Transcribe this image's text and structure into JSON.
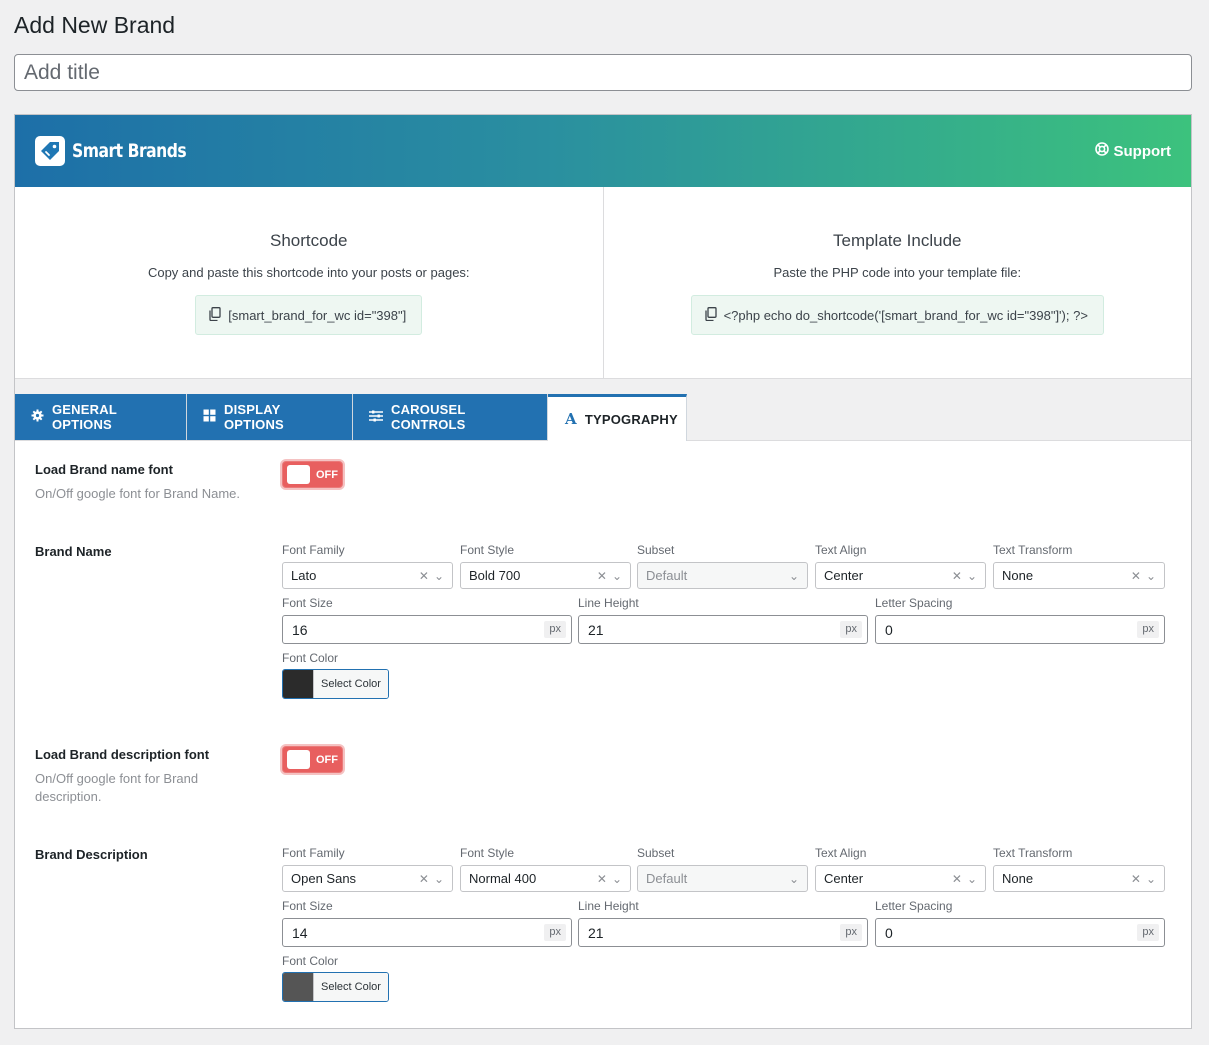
{
  "page": {
    "heading": "Add New Brand",
    "title_placeholder": "Add title"
  },
  "banner": {
    "logo_text": "Smart Brands",
    "support_label": "Support"
  },
  "shortcode": {
    "title": "Shortcode",
    "description": "Copy and paste this shortcode into your posts or pages:",
    "code": "[smart_brand_for_wc id=\"398\"]"
  },
  "template": {
    "title": "Template Include",
    "description": "Paste the PHP code into your template file:",
    "code": "<?php echo do_shortcode('[smart_brand_for_wc id=\"398\"]'); ?>"
  },
  "tabs": [
    {
      "label": "GENERAL OPTIONS",
      "icon": "gear-icon"
    },
    {
      "label": "DISPLAY OPTIONS",
      "icon": "grid-icon"
    },
    {
      "label": "CAROUSEL CONTROLS",
      "icon": "sliders-icon"
    },
    {
      "label": "TYPOGRAPHY",
      "icon": "font-icon",
      "active": true
    }
  ],
  "field_labels": {
    "font_family": "Font Family",
    "font_style": "Font Style",
    "subset": "Subset",
    "text_align": "Text Align",
    "text_transform": "Text Transform",
    "font_size": "Font Size",
    "line_height": "Line Height",
    "letter_spacing": "Letter Spacing",
    "font_color": "Font Color",
    "unit": "px",
    "select_color": "Select Color"
  },
  "name_font_toggle": {
    "label": "Load Brand name font",
    "description": "On/Off google font for Brand Name.",
    "state": "OFF"
  },
  "brand_name": {
    "label": "Brand Name",
    "font_family": "Lato",
    "font_style": "Bold 700",
    "subset": "Default",
    "text_align": "Center",
    "text_transform": "None",
    "font_size": "16",
    "line_height": "21",
    "letter_spacing": "0",
    "color": "#2b2b2b"
  },
  "desc_font_toggle": {
    "label": "Load Brand description font",
    "description_line1": "On/Off google font for Brand",
    "description_line2": "description.",
    "state": "OFF"
  },
  "brand_description": {
    "label": "Brand Description",
    "font_family": "Open Sans",
    "font_style": "Normal 400",
    "subset": "Default",
    "text_align": "Center",
    "text_transform": "None",
    "font_size": "14",
    "line_height": "21",
    "letter_spacing": "0",
    "color": "#555555"
  }
}
